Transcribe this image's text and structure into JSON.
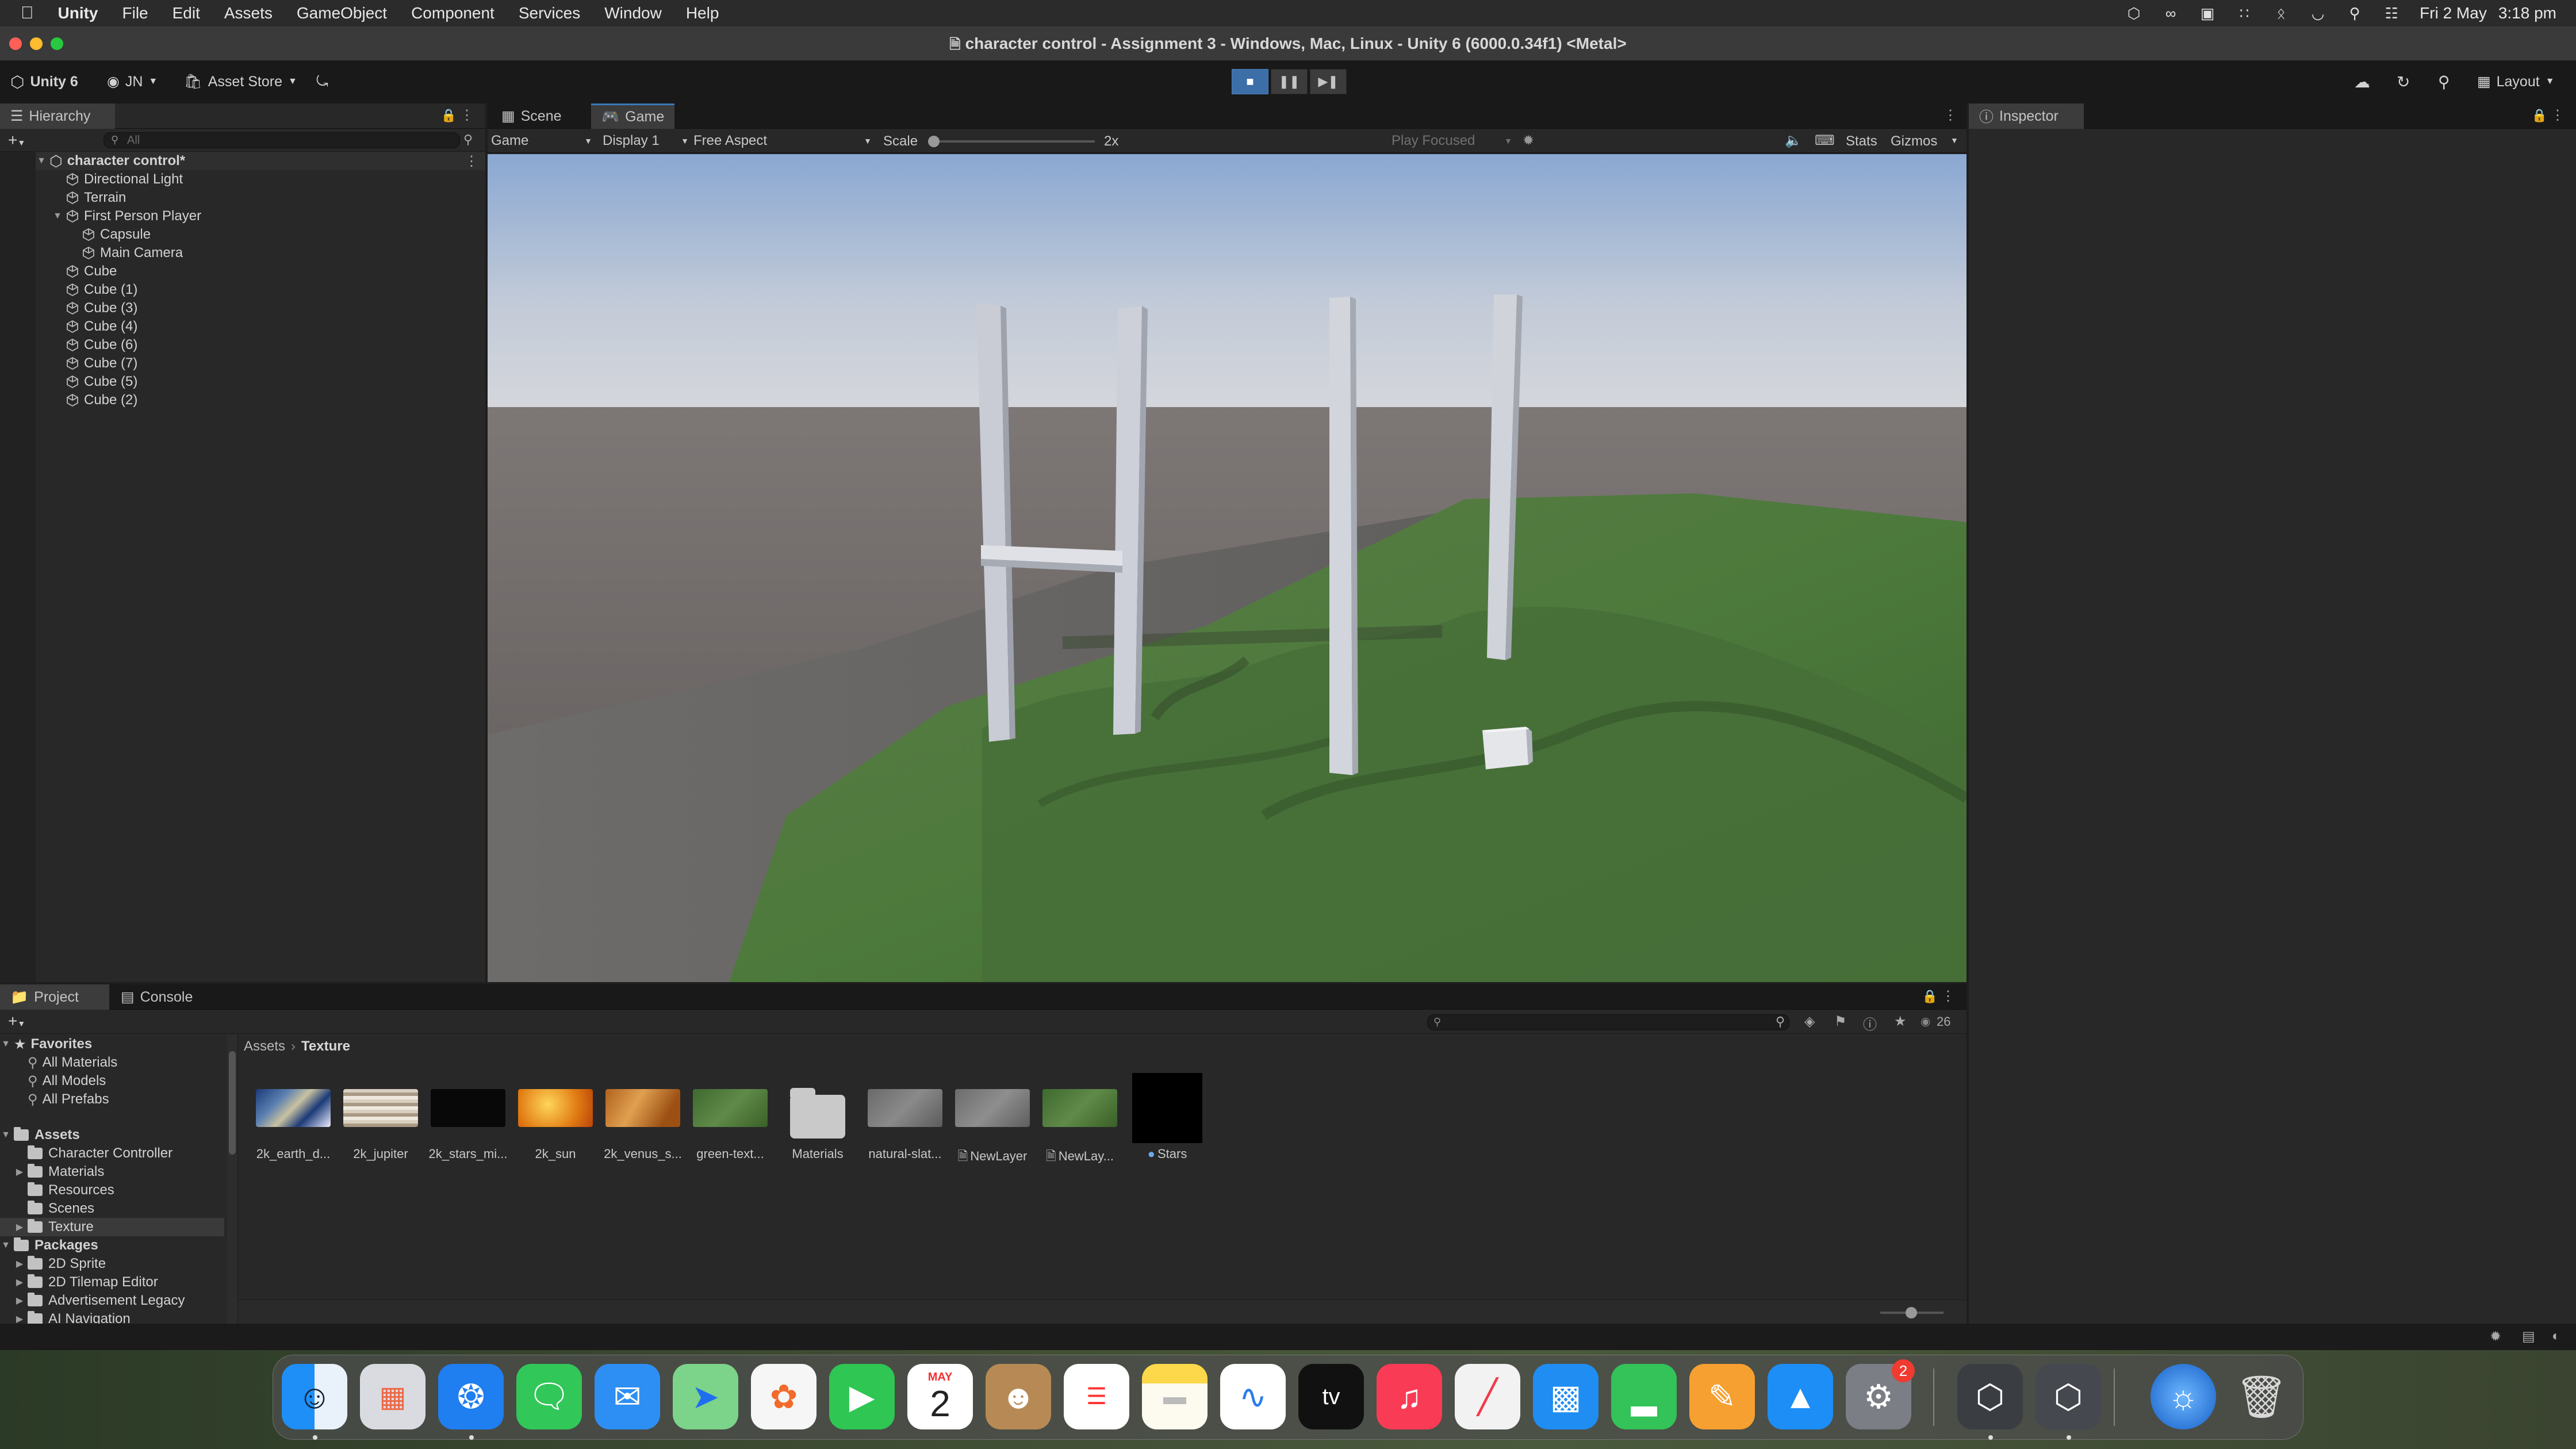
{
  "menubar": {
    "app": "Unity",
    "items": [
      "File",
      "Edit",
      "Assets",
      "GameObject",
      "Component",
      "Services",
      "Window",
      "Help"
    ],
    "date": "Fri 2 May",
    "time": "3:18 pm"
  },
  "window": {
    "title": "character control - Assignment 3 - Windows, Mac, Linux - Unity 6 (6000.0.34f1) <Metal>"
  },
  "toolbar": {
    "unity_label": "Unity 6",
    "account": "JN",
    "asset_store": "Asset Store",
    "layout": "Layout"
  },
  "hierarchy": {
    "tab": "Hierarchy",
    "search_placeholder": "All",
    "scene": "character control*",
    "items": [
      {
        "label": "Directional Light",
        "indent": 1
      },
      {
        "label": "Terrain",
        "indent": 1
      },
      {
        "label": "First Person Player",
        "indent": 1,
        "expanded": true
      },
      {
        "label": "Capsule",
        "indent": 2
      },
      {
        "label": "Main Camera",
        "indent": 2
      },
      {
        "label": "Cube",
        "indent": 1
      },
      {
        "label": "Cube (1)",
        "indent": 1
      },
      {
        "label": "Cube (3)",
        "indent": 1
      },
      {
        "label": "Cube (4)",
        "indent": 1
      },
      {
        "label": "Cube (6)",
        "indent": 1
      },
      {
        "label": "Cube (7)",
        "indent": 1
      },
      {
        "label": "Cube (5)",
        "indent": 1
      },
      {
        "label": "Cube (2)",
        "indent": 1
      }
    ]
  },
  "viewtabs": {
    "scene": "Scene",
    "game": "Game",
    "active": "Game"
  },
  "gamebar": {
    "mode": "Game",
    "display": "Display 1",
    "aspect": "Free Aspect",
    "scale_label": "Scale",
    "scale_value": "2x",
    "play_focused": "Play Focused",
    "stats": "Stats",
    "gizmos": "Gizmos"
  },
  "inspector": {
    "tab": "Inspector"
  },
  "project": {
    "tab_project": "Project",
    "tab_console": "Console",
    "item_count": "26",
    "breadcrumb": [
      "Assets",
      "Texture"
    ],
    "favorites": {
      "label": "Favorites",
      "items": [
        "All Materials",
        "All Models",
        "All Prefabs"
      ]
    },
    "assets": {
      "label": "Assets",
      "items": [
        "Character Controller",
        "Materials",
        "Resources",
        "Scenes",
        "Texture"
      ]
    },
    "packages": {
      "label": "Packages",
      "items": [
        "2D Sprite",
        "2D Tilemap Editor",
        "Advertisement Legacy",
        "AI Navigation"
      ]
    },
    "files": [
      {
        "label": "2k_earth_d...",
        "icon": "earth-texture"
      },
      {
        "label": "2k_jupiter",
        "icon": "jupiter-texture"
      },
      {
        "label": "2k_stars_mi...",
        "icon": "stars-texture"
      },
      {
        "label": "2k_sun",
        "icon": "sun-texture"
      },
      {
        "label": "2k_venus_s...",
        "icon": "venus-texture"
      },
      {
        "label": "green-text...",
        "icon": "grass-texture"
      },
      {
        "label": "Materials",
        "icon": "folder-icon"
      },
      {
        "label": "natural-slat...",
        "icon": "slate-texture"
      },
      {
        "label": "NewLayer",
        "icon": "layer-texture"
      },
      {
        "label": "NewLay...",
        "icon": "layer-grass-texture"
      },
      {
        "label": "Stars",
        "icon": "skybox-material"
      }
    ]
  },
  "dock": {
    "calendar_month": "MAY",
    "calendar_day": "2",
    "settings_badge": "2",
    "appletv": "tv"
  }
}
